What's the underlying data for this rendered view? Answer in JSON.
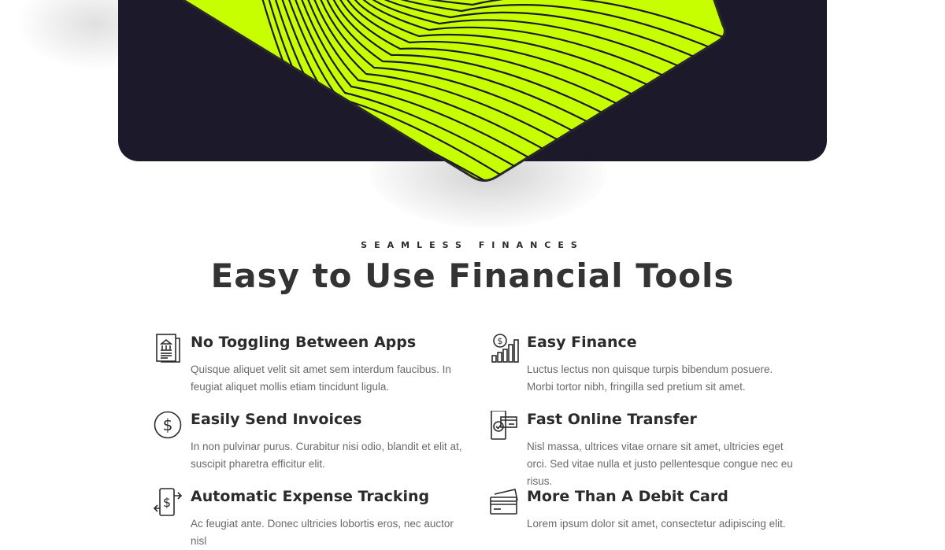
{
  "section": {
    "eyebrow": "SEAMLESS FINANCES",
    "headline": "Easy to Use Financial Tools"
  },
  "colors": {
    "hero_bg": "#1c1a2a",
    "card_accent": "#c8ff00",
    "text_dark": "#2b2b2b",
    "text_muted": "#6a6a6a"
  },
  "features": [
    {
      "icon": "bank-document-icon",
      "title": "No Toggling Between Apps",
      "desc": "Quisque aliquet velit sit amet sem interdum faucibus. In feugiat aliquet mollis etiam tincidunt ligula."
    },
    {
      "icon": "coin-growth-chart-icon",
      "title": "Easy Finance",
      "desc": "Luctus lectus non quisque turpis bibendum posuere. Morbi tortor nibh, fringilla sed pretium sit amet."
    },
    {
      "icon": "dollar-circle-icon",
      "title": "Easily Send Invoices",
      "desc": "In non pulvinar purus. Curabitur nisi odio, blandit et elit at, suscipit pharetra efficitur elit."
    },
    {
      "icon": "phone-card-check-icon",
      "title": "Fast Online Transfer",
      "desc": "Nisl massa, ultrices vitae ornare sit amet, ultricies eget orci. Sed vitae nulla et justo pellentesque congue nec eu risus."
    },
    {
      "icon": "mobile-transfer-icon",
      "title": "Automatic Expense Tracking",
      "desc": "Ac feugiat ante. Donec ultricies lobortis eros, nec auctor nisl"
    },
    {
      "icon": "credit-cards-icon",
      "title": "More Than A Debit Card",
      "desc": "Lorem ipsum dolor sit amet, consectetur adipiscing elit."
    }
  ]
}
